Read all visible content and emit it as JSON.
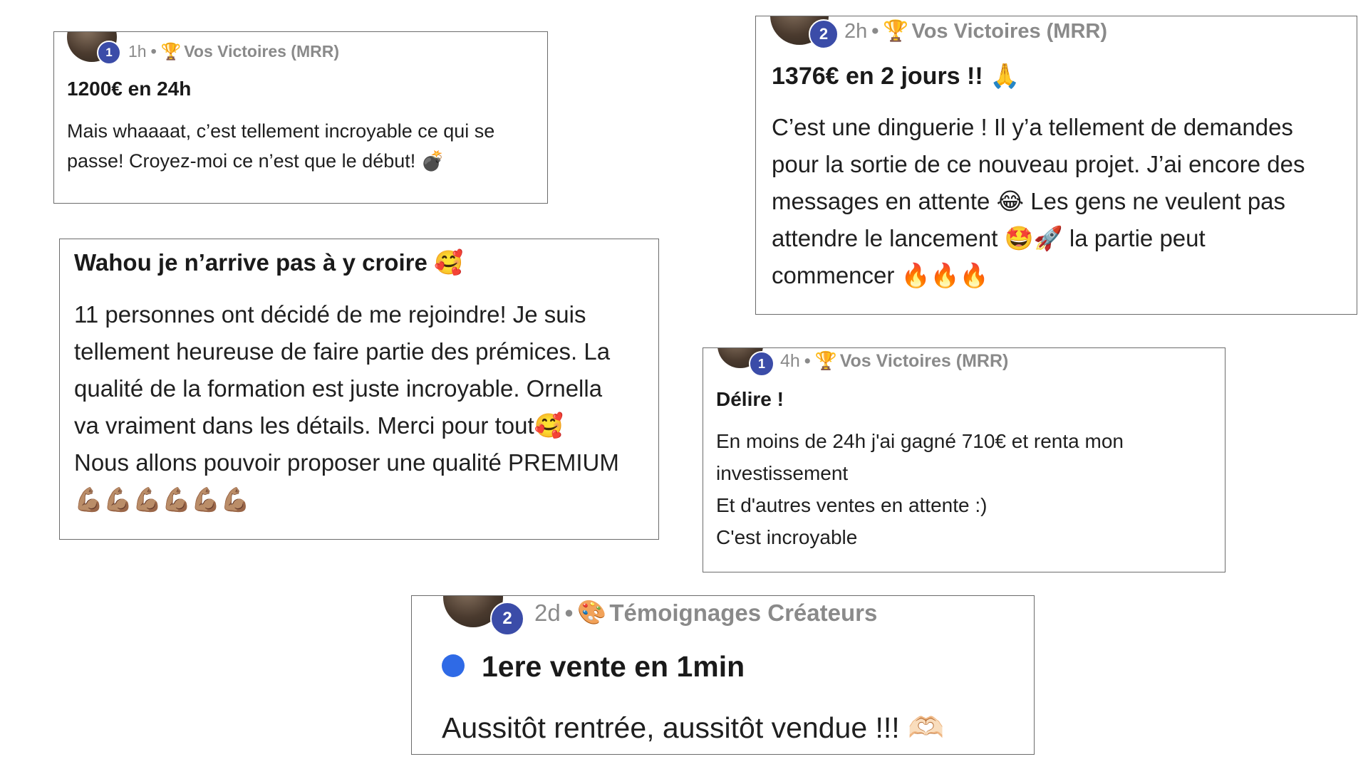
{
  "colors": {
    "border": "#6b6b6b",
    "badge": "#3b4ca8",
    "meta_text": "#8a8a8a",
    "blue_dot": "#2f6ae6"
  },
  "card1": {
    "badge": "1",
    "time": "1h",
    "dot": "•",
    "category_icon": "trophy-icon",
    "category_emoji": "🏆",
    "category": "Vos Victoires (MRR)",
    "title": "1200€ en 24h",
    "body": [
      "Mais whaaaat, c’est tellement incroyable ce qui se",
      "passe! Croyez-moi ce n’est que le début! 💣"
    ]
  },
  "card2": {
    "badge": "2",
    "time": "2h",
    "dot": "•",
    "category_icon": "trophy-icon",
    "category_emoji": "🏆",
    "category": "Vos Victoires (MRR)",
    "title": "1376€ en 2 jours !! 🙏",
    "body": [
      "C’est une dinguerie ! Il y’a tellement de demandes",
      "pour la sortie de ce nouveau projet. J’ai encore des",
      "messages en attente 😂 Les gens ne veulent pas",
      "attendre le lancement 🤩🚀 la partie peut",
      "commencer 🔥🔥🔥"
    ]
  },
  "card3": {
    "title": "Wahou je n’arrive pas à y croire 🥰",
    "body": [
      "11 personnes ont décidé de me rejoindre! Je suis",
      "tellement heureuse de faire partie des prémices. La",
      "qualité de la formation est juste incroyable. Ornella",
      "va vraiment dans les détails. Merci pour tout🥰",
      "Nous allons pouvoir proposer une qualité PREMIUM",
      "💪🏽💪🏽💪🏽💪🏽💪🏽💪🏽"
    ]
  },
  "card4": {
    "badge": "1",
    "time": "4h",
    "dot": "•",
    "category_icon": "trophy-icon",
    "category_emoji": "🏆",
    "category": "Vos Victoires (MRR)",
    "title": "Délire !",
    "body": [
      "En moins de 24h j'ai gagné 710€ et renta mon",
      "investissement",
      "Et d'autres ventes en attente :)",
      "C'est incroyable"
    ]
  },
  "card5": {
    "badge": "2",
    "time": "2d",
    "dot": "•",
    "category_icon": "palette-icon",
    "category_emoji": "🎨",
    "category": "Témoignages Créateurs",
    "title": "1ere vente en 1min",
    "body": [
      "Aussitôt rentrée, aussitôt vendue !!! 🫶🏻"
    ]
  }
}
